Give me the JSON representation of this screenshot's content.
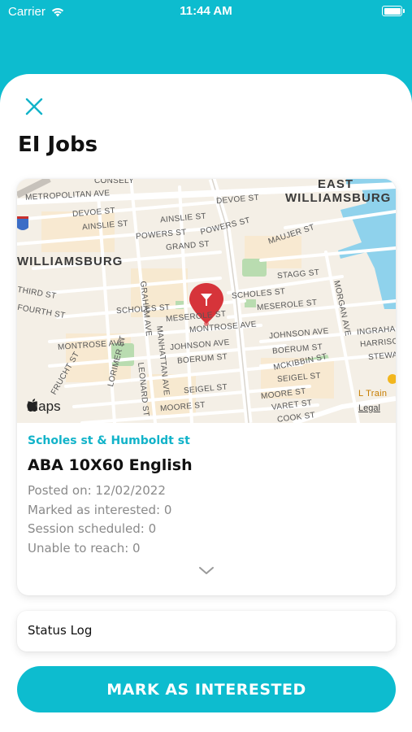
{
  "status_bar": {
    "carrier": "Carrier",
    "time": "11:44 AM"
  },
  "header": {
    "title": "EI Jobs"
  },
  "job": {
    "location": "Scholes st & Humboldt st",
    "title": "ABA 10X60 English",
    "stats": [
      "Posted on: 12/02/2022",
      "Marked as interested: 0",
      "Session scheduled: 0",
      "Unable to reach: 0"
    ]
  },
  "map": {
    "provider": "Maps",
    "legal": "Legal",
    "areas": [
      "EAST",
      "WILLIAMSBURG",
      "WILLIAMSBURG"
    ],
    "streets": [
      "CONSELY",
      "METROPOLITAN AVE",
      "DEVOE ST",
      "DEVOE ST",
      "AINSLIE ST",
      "AINSLIE ST",
      "POWERS ST",
      "POWERS ST",
      "GRAND ST",
      "MAUJER ST",
      "STAGG ST",
      "SCHOLES ST",
      "SCHOLES ST",
      "MESEROLE ST",
      "MESEROLE ST",
      "MONTROSE AVE",
      "MONTROSE AVE",
      "JOHNSON AVE",
      "JOHNSON AVE",
      "BOERUM ST",
      "BOERUM ST",
      "MCKIBBIN ST",
      "SEIGEL ST",
      "SEIGEL ST",
      "MOORE ST",
      "MOORE ST",
      "VARET ST",
      "COOK ST",
      "GRAHAM AVE",
      "MANHATTAN AVE",
      "LEONARD ST",
      "LORIMER ST",
      "MORGAN AVE",
      "INGRAHAM",
      "HARRISON",
      "STEWART",
      "THIRD ST",
      "FOURTH ST",
      "FRUCHT ST",
      "L Train"
    ]
  },
  "status_log": {
    "label": "Status Log"
  },
  "actions": {
    "primary_label": "MARK AS INTERESTED"
  },
  "colors": {
    "accent": "#0dbccf",
    "location_text": "#12b3c9",
    "pin": "#d6343a"
  }
}
